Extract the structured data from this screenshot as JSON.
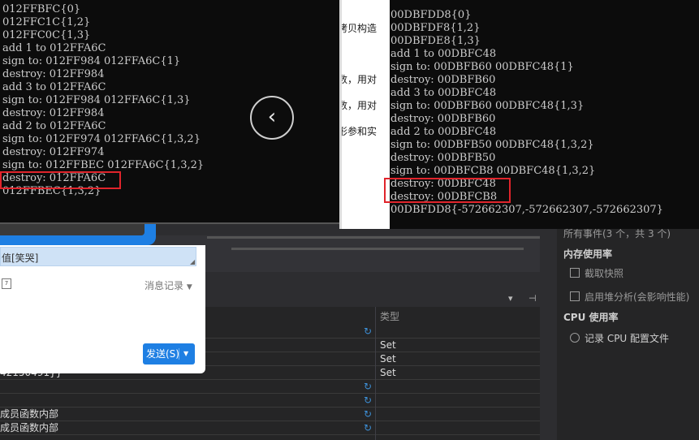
{
  "console_left": {
    "lines": [
      "012FFBFC{0}",
      "012FFC1C{1,2}",
      "012FFC0C{1,3}",
      "add 1 to 012FFA6C",
      "sign to: 012FF984 012FFA6C{1}",
      "destroy: 012FF984",
      "add 3 to 012FFA6C",
      "sign to: 012FF984 012FFA6C{1,3}",
      "destroy: 012FF984",
      "add 2 to 012FFA6C",
      "sign to: 012FF974 012FFA6C{1,3,2}",
      "destroy: 012FF974",
      "sign to: 012FFBEC 012FFA6C{1,3,2}",
      "destroy: 012FFA6C",
      "012FFBEC{1,3,2}"
    ]
  },
  "console_right": {
    "lines": [
      "00DBFDD8{0}",
      "00DBFDF8{1,2}",
      "00DBFDE8{1,3}",
      "add 1 to 00DBFC48",
      "sign to: 00DBFB60 00DBFC48{1}",
      "destroy: 00DBFB60",
      "add 3 to 00DBFC48",
      "sign to: 00DBFB60 00DBFC48{1,3}",
      "destroy: 00DBFB60",
      "add 2 to 00DBFC48",
      "sign to: 00DBFB50 00DBFC48{1,3,2}",
      "destroy: 00DBFB50",
      "sign to: 00DBFCB8 00DBFC48{1,3,2}",
      "destroy: 00DBFC48",
      "destroy: 00DBFCB8",
      "00DBFDD8{-572662307,-572662307,-572662307}"
    ]
  },
  "doc_strip": {
    "lines": [
      "拷贝构造",
      "数，用对",
      "数，用对",
      "形参和实"
    ]
  },
  "chat": {
    "input_text": "值[笑哭]",
    "calendar_glyph": "7",
    "message_history_label": "消息记录",
    "send_label": "发送(S)"
  },
  "ide_table": {
    "type_header": "类型",
    "rows": [
      {
        "left": "",
        "type": "",
        "refresh": true
      },
      {
        "left": "",
        "type": "Set",
        "refresh": false
      },
      {
        "left": "",
        "type": "Set",
        "refresh": false
      },
      {
        "left": "42150491}}",
        "type": "Set",
        "refresh": false
      },
      {
        "left": "",
        "type": "",
        "refresh": true
      },
      {
        "left": "",
        "type": "",
        "refresh": true
      },
      {
        "left": "成员函数内部",
        "type": "",
        "refresh": true
      },
      {
        "left": "成员函数内部",
        "type": "",
        "refresh": true
      }
    ]
  },
  "diagnostics": {
    "events_text": "所有事件(3 个，共 3 个)",
    "memory_title": "内存使用率",
    "snapshot_label": "截取快照",
    "heap_label": "启用堆分析(会影响性能)",
    "cpu_title": "CPU 使用率",
    "cpu_record_label": "记录 CPU 配置文件"
  },
  "colors": {
    "highlight_red": "#e0242b",
    "accent_blue": "#1e7fe3",
    "console_bg": "#0c0c0c"
  },
  "icons": {
    "prev": "chevron-left-icon",
    "refresh": "refresh-icon"
  }
}
